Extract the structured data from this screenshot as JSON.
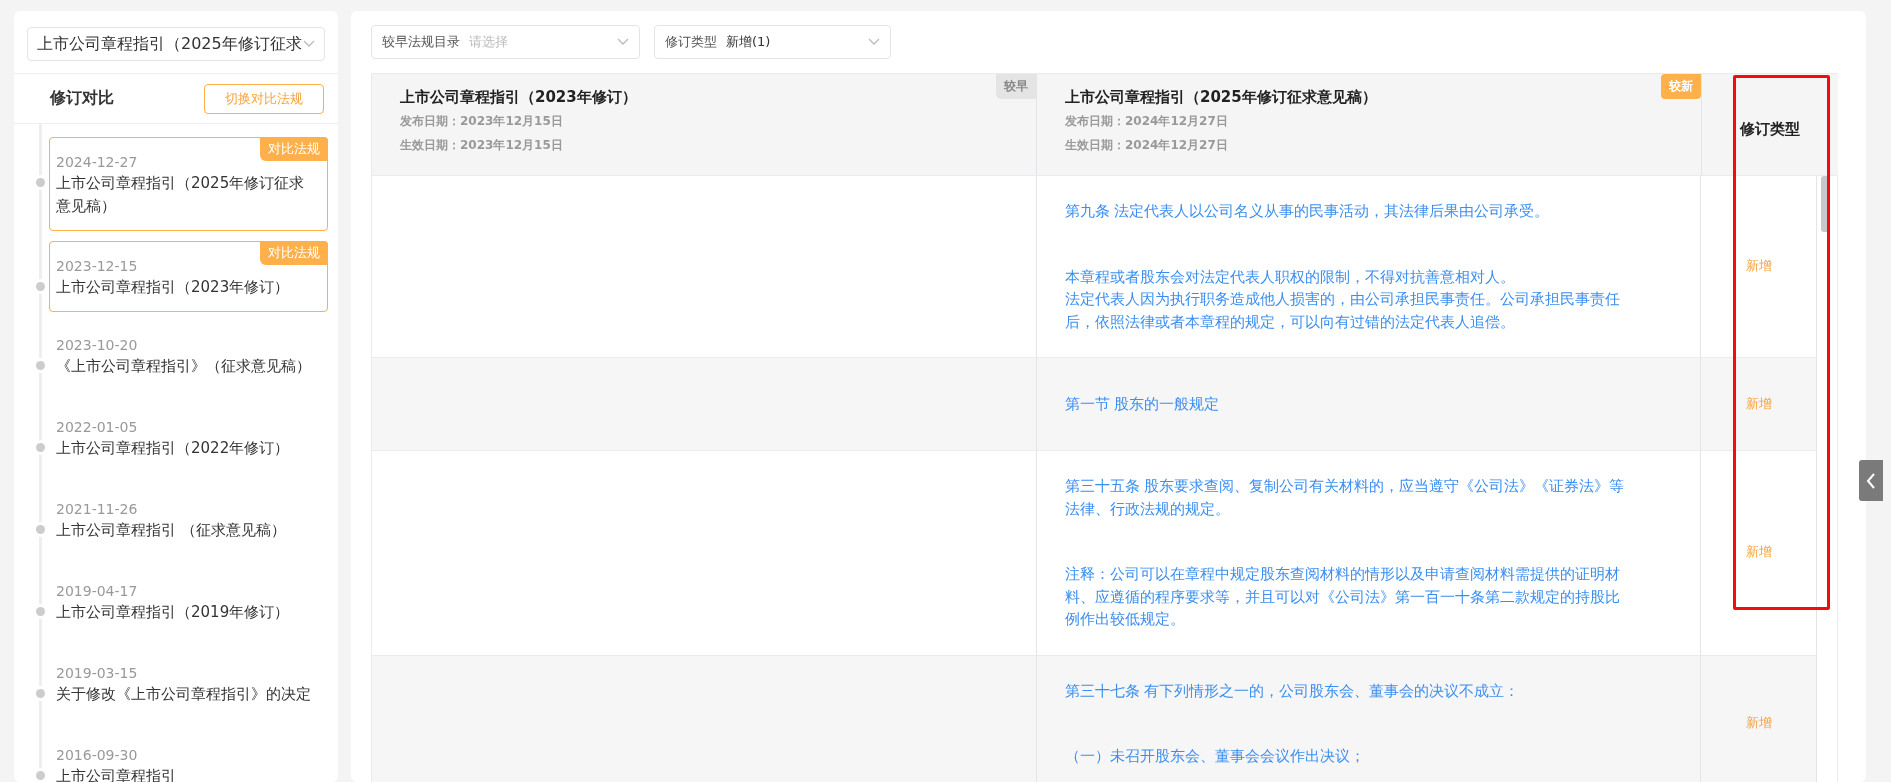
{
  "sidebar": {
    "version_select": "上市公司章程指引（2025年修订征求",
    "title": "修订对比",
    "switch_button": "切换对比法规",
    "timeline": [
      {
        "date": "2024-12-27",
        "title": "上市公司章程指引（2025年修订征求意见稿）",
        "selected": true,
        "badge": "对比法规"
      },
      {
        "date": "2023-12-15",
        "title": "上市公司章程指引（2023年修订）",
        "selected": true,
        "badge": "对比法规"
      },
      {
        "date": "2023-10-20",
        "title": "《上市公司章程指引》（征求意见稿）",
        "selected": false
      },
      {
        "date": "2022-01-05",
        "title": "上市公司章程指引（2022年修订）",
        "selected": false
      },
      {
        "date": "2021-11-26",
        "title": "上市公司章程指引 （征求意见稿）",
        "selected": false
      },
      {
        "date": "2019-04-17",
        "title": "上市公司章程指引（2019年修订）",
        "selected": false
      },
      {
        "date": "2019-03-15",
        "title": "关于修改《上市公司章程指引》的决定",
        "selected": false
      },
      {
        "date": "2016-09-30",
        "title": "上市公司章程指引",
        "selected": false
      }
    ]
  },
  "filters": [
    {
      "label": "较早法规目录",
      "placeholder": "请选择"
    },
    {
      "label": "修订类型",
      "value": "新增(1)"
    }
  ],
  "table": {
    "columns": [
      {
        "kind": "older",
        "title": "上市公司章程指引（2023年修订）",
        "publish_date": "发布日期：2023年12月15日",
        "effective_date": "生效日期：2023年12月15日",
        "tag": "较早"
      },
      {
        "kind": "newer",
        "title": "上市公司章程指引（2025年修订征求意见稿）",
        "publish_date": "发布日期：2024年12月27日",
        "effective_date": "生效日期：2024年12月27日",
        "tag": "较新"
      }
    ],
    "type_header": "修订类型",
    "rows": [
      {
        "new": [
          [
            "第九条 法定代表人以公司名义从事的民事活动，其法律后果由公司承受。"
          ],
          [
            "本章程或者股东会对法定代表人职权的限制，不得对抗善意相对人。",
            "法定代表人因为执行职务造成他人损害的，由公司承担民事责任。公司承担民事责任后，依照法律或者本章程的规定，可以向有过错的法定代表人追偿。"
          ]
        ],
        "type": "新增"
      },
      {
        "new": [
          [
            "第一节 股东的一般规定"
          ]
        ],
        "type": "新增"
      },
      {
        "new": [
          [
            "第三十五条 股东要求查阅、复制公司有关材料的，应当遵守《公司法》《证券法》等法律、行政法规的规定。"
          ],
          [
            "注释：公司可以在章程中规定股东查阅材料的情形以及申请查阅材料需提供的证明材料、应遵循的程序要求等，并且可以对《公司法》第一百一十条第二款规定的持股比例作出较低规定。"
          ]
        ],
        "type": "新增"
      },
      {
        "new": [
          [
            "第三十七条 有下列情形之一的，公司股东会、董事会的决议不成立："
          ],
          [
            "（一）未召开股东会、董事会会议作出决议；"
          ]
        ],
        "type": "新增"
      }
    ]
  }
}
